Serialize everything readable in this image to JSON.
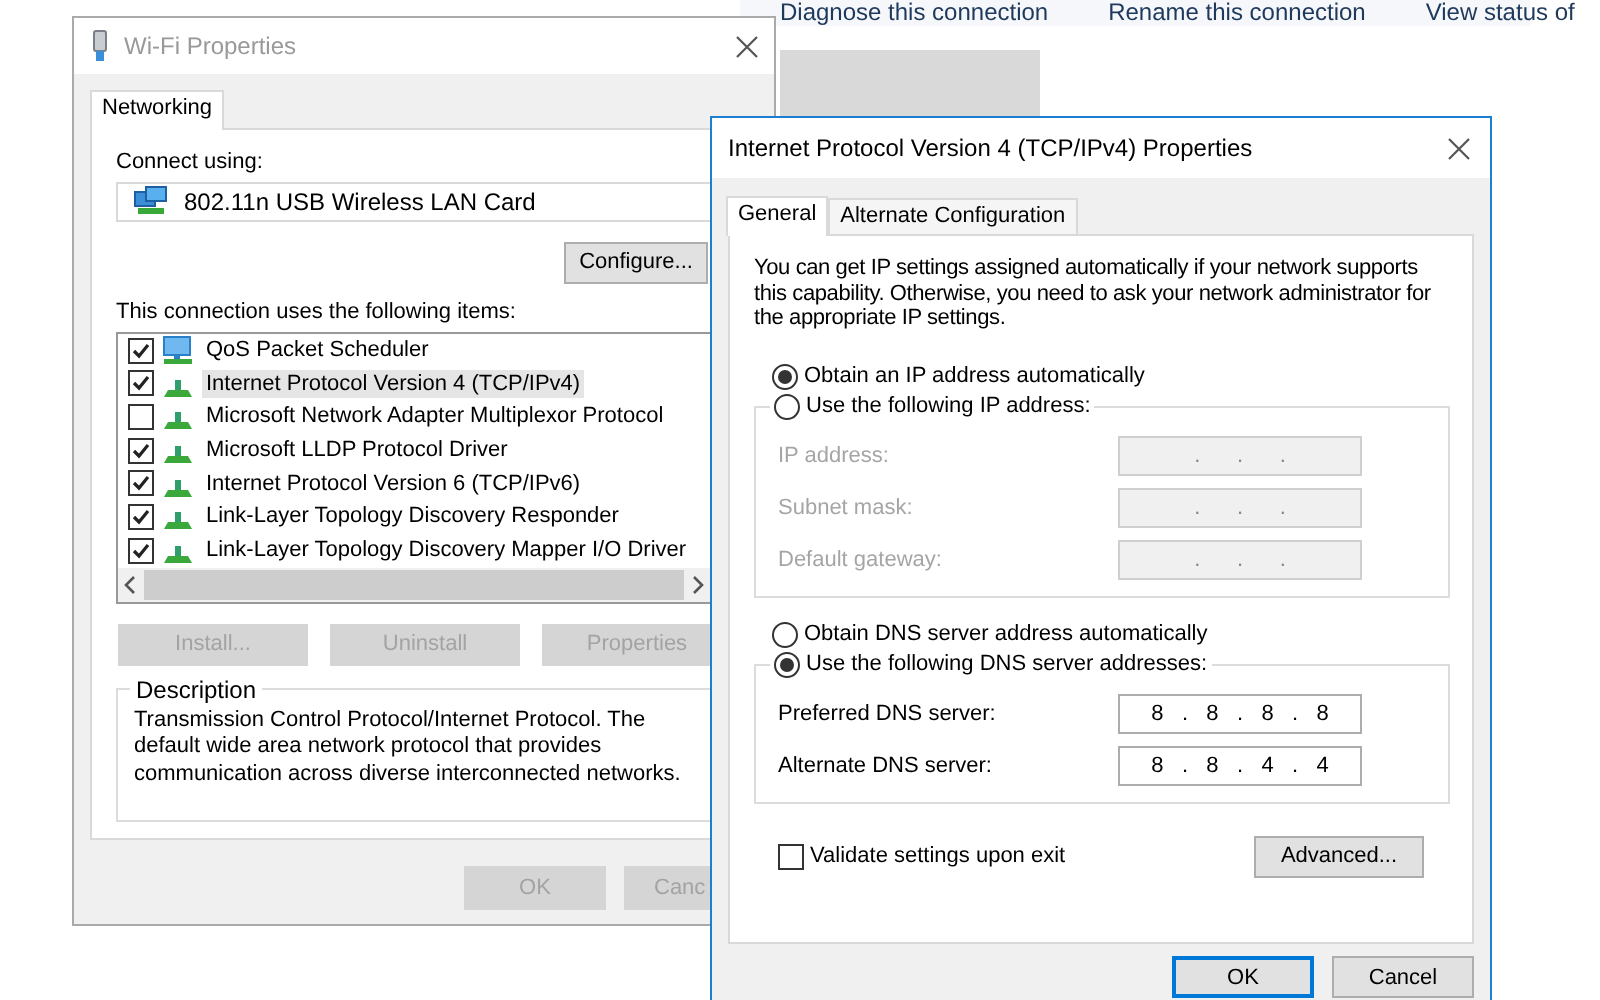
{
  "explorer_toolbar": {
    "links": [
      "Diagnose this connection",
      "Rename this connection",
      "View status of"
    ]
  },
  "wifi_window": {
    "title": "Wi-Fi Properties",
    "active": false,
    "tabs": [
      {
        "label": "Networking",
        "selected": true
      }
    ],
    "connect_using_label": "Connect using:",
    "adapter": "802.11n USB Wireless LAN Card",
    "configure_button": "Configure...",
    "items_label": "This connection uses the following items:",
    "items": [
      {
        "label": "QoS Packet Scheduler",
        "kind": "service",
        "checked": true,
        "selected": false
      },
      {
        "label": "Internet Protocol Version 4 (TCP/IPv4)",
        "kind": "protocol",
        "checked": true,
        "selected": true
      },
      {
        "label": "Microsoft Network Adapter Multiplexor Protocol",
        "kind": "protocol",
        "checked": false,
        "selected": false
      },
      {
        "label": "Microsoft LLDP Protocol Driver",
        "kind": "protocol",
        "checked": true,
        "selected": false
      },
      {
        "label": "Internet Protocol Version 6 (TCP/IPv6)",
        "kind": "protocol",
        "checked": true,
        "selected": false
      },
      {
        "label": "Link-Layer Topology Discovery Responder",
        "kind": "protocol",
        "checked": true,
        "selected": false
      },
      {
        "label": "Link-Layer Topology Discovery Mapper I/O Driver",
        "kind": "protocol",
        "checked": true,
        "selected": false
      }
    ],
    "item_buttons": [
      {
        "label": "Install...",
        "disabled": true
      },
      {
        "label": "Uninstall",
        "disabled": true
      },
      {
        "label": "Properties",
        "disabled": true
      }
    ],
    "description": {
      "title": "Description",
      "text": "Transmission Control Protocol/Internet Protocol. The default wide area network protocol that provides communication across diverse interconnected networks."
    },
    "buttons": [
      {
        "label": "OK",
        "disabled": true
      },
      {
        "label": "Canc",
        "disabled": true
      }
    ]
  },
  "ipv4_window": {
    "title": "Internet Protocol Version 4 (TCP/IPv4) Properties",
    "active": true,
    "tabs": [
      {
        "label": "General",
        "selected": true
      },
      {
        "label": "Alternate Configuration",
        "selected": false
      }
    ],
    "intro": "You can get IP settings assigned automatically if your network supports this capability. Otherwise, you need to ask your network administrator for the appropriate IP settings.",
    "ip_mode": [
      {
        "label": "Obtain an IP address automatically",
        "selected": true
      },
      {
        "label": "Use the following IP address:",
        "selected": false
      }
    ],
    "ip_fields": [
      {
        "label": "IP address:",
        "value": ".      .      .",
        "disabled": true
      },
      {
        "label": "Subnet mask:",
        "value": ".      .      .",
        "disabled": true
      },
      {
        "label": "Default gateway:",
        "value": ".      .      .",
        "disabled": true
      }
    ],
    "dns_mode": [
      {
        "label": "Obtain DNS server address automatically",
        "selected": false
      },
      {
        "label": "Use the following DNS server addresses:",
        "selected": true
      }
    ],
    "dns_fields": [
      {
        "label": "Preferred DNS server:",
        "value": "8   .   8   .   8   .   8",
        "disabled": false
      },
      {
        "label": "Alternate DNS server:",
        "value": "8   .   8   .   4   .   4",
        "disabled": false
      }
    ],
    "validate": {
      "label": "Validate settings upon exit",
      "checked": false
    },
    "advanced_button": "Advanced...",
    "buttons": [
      {
        "label": "OK",
        "default": true
      },
      {
        "label": "Cancel",
        "default": false
      }
    ]
  }
}
